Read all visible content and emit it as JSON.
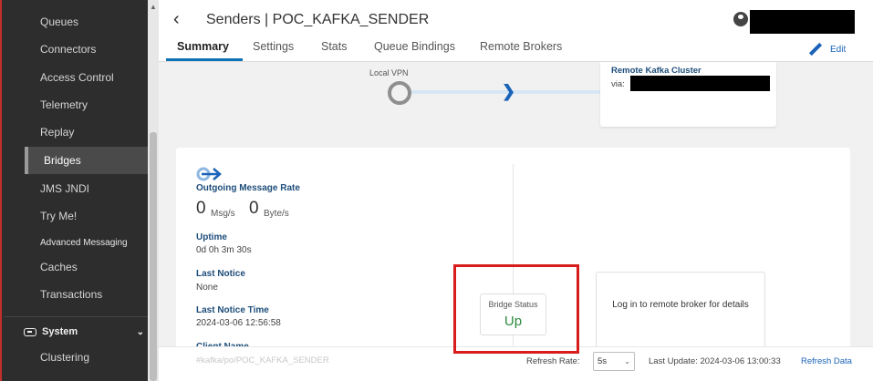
{
  "sidebar": {
    "items": [
      {
        "label": "Queues"
      },
      {
        "label": "Connectors"
      },
      {
        "label": "Access Control"
      },
      {
        "label": "Telemetry"
      },
      {
        "label": "Replay"
      },
      {
        "label": "Bridges",
        "active": true
      },
      {
        "label": "JMS JNDI"
      },
      {
        "label": "Try Me!"
      },
      {
        "label": "Advanced Messaging"
      },
      {
        "label": "Caches"
      },
      {
        "label": "Transactions"
      }
    ],
    "system_label": "System",
    "clustering_label": "Clustering"
  },
  "header": {
    "title": "Senders | POC_KAFKA_SENDER",
    "edit_label": "Edit"
  },
  "tabs": [
    {
      "label": "Summary",
      "active": true
    },
    {
      "label": "Settings"
    },
    {
      "label": "Stats"
    },
    {
      "label": "Queue Bindings"
    },
    {
      "label": "Remote Brokers"
    }
  ],
  "flow": {
    "local_vpn_label": "Local VPN",
    "remote_title": "Remote Kafka Cluster",
    "via_label": "via:"
  },
  "summary": {
    "outgoing_rate_label": "Outgoing Message Rate",
    "msg_rate": "0",
    "msg_unit": "Msg/s",
    "byte_rate": "0",
    "byte_unit": "Byte/s",
    "uptime_label": "Uptime",
    "uptime_value": "0d 0h 3m 30s",
    "last_notice_label": "Last Notice",
    "last_notice_value": "None",
    "last_notice_time_label": "Last Notice Time",
    "last_notice_time_value": "2024-03-06 12:56:58",
    "client_name_label": "Client Name",
    "client_name_value": "#kafka/po/POC_KAFKA_SENDER"
  },
  "bridge_status": {
    "label": "Bridge Status",
    "value": "Up"
  },
  "remote_login": {
    "text": "Log in to remote broker for details"
  },
  "footer": {
    "refresh_rate_label": "Refresh Rate:",
    "refresh_rate_value": "5s",
    "last_update": "Last Update: 2024-03-06 13:00:33",
    "refresh_label": "Refresh Data"
  },
  "colors": {
    "accent": "#1a63b8",
    "sidebar_bg": "#2d2d2d",
    "status_up": "#2a8a3e",
    "highlight": "#d81b1b"
  }
}
